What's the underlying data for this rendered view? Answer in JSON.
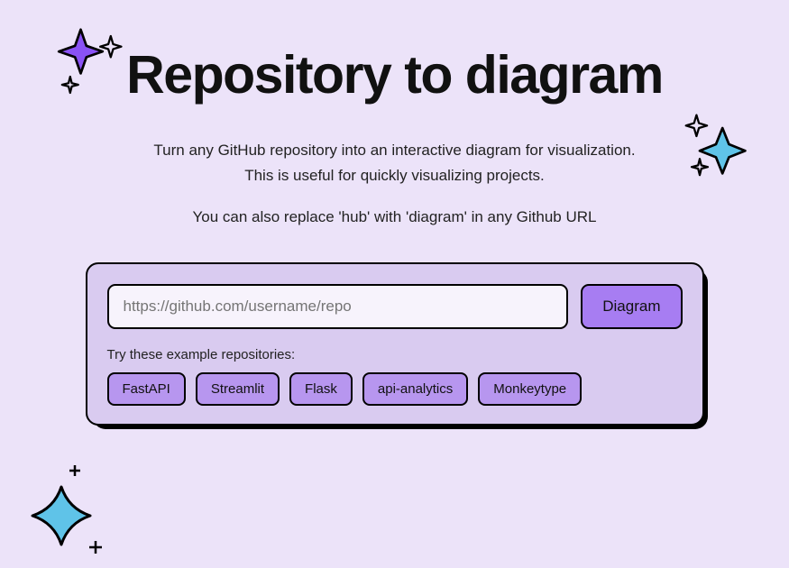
{
  "hero": {
    "title": "Repository to diagram",
    "subtitle1": "Turn any GitHub repository into an interactive diagram for visualization.",
    "subtitle2": "This is useful for quickly visualizing projects.",
    "tip": "You can also replace 'hub' with 'diagram' in any Github URL"
  },
  "form": {
    "input_placeholder": "https://github.com/username/repo",
    "input_value": "",
    "submit_label": "Diagram",
    "examples_label": "Try these example repositories:",
    "examples": [
      {
        "label": "FastAPI"
      },
      {
        "label": "Streamlit"
      },
      {
        "label": "Flask"
      },
      {
        "label": "api-analytics"
      },
      {
        "label": "Monkeytype"
      }
    ]
  },
  "icons": {
    "sparkle_purple": "sparkle-icon",
    "sparkle_blue_right": "sparkle-icon",
    "sparkle_blue_bottom": "sparkle-icon"
  }
}
